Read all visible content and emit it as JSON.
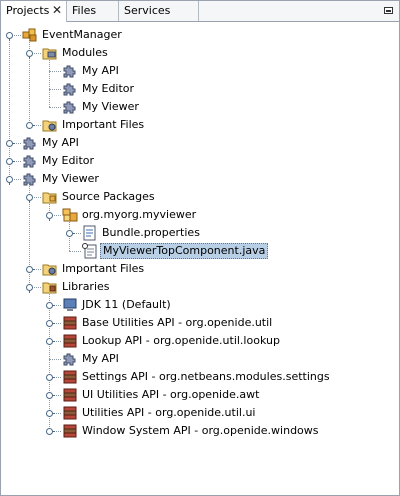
{
  "tabs": [
    {
      "label": "Projects",
      "active": true
    },
    {
      "label": "Files",
      "active": false
    },
    {
      "label": "Services",
      "active": false
    }
  ],
  "tree": [
    {
      "label": "EventManager",
      "depth": 0,
      "icon": "suite-icon",
      "state": "open"
    },
    {
      "label": "Modules",
      "depth": 1,
      "icon": "modules-folder-icon",
      "state": "open"
    },
    {
      "label": "My API",
      "depth": 2,
      "icon": "module-icon",
      "state": "leaf"
    },
    {
      "label": "My Editor",
      "depth": 2,
      "icon": "module-icon",
      "state": "leaf"
    },
    {
      "label": "My Viewer",
      "depth": 2,
      "icon": "module-icon",
      "state": "leaf"
    },
    {
      "label": "Important Files",
      "depth": 1,
      "icon": "important-files-icon",
      "state": "closed"
    },
    {
      "label": "My API",
      "depth": 0,
      "icon": "module-icon",
      "state": "closed"
    },
    {
      "label": "My Editor",
      "depth": 0,
      "icon": "module-icon",
      "state": "closed"
    },
    {
      "label": "My Viewer",
      "depth": 0,
      "icon": "module-icon",
      "state": "open"
    },
    {
      "label": "Source Packages",
      "depth": 1,
      "icon": "source-packages-icon",
      "state": "open"
    },
    {
      "label": "org.myorg.myviewer",
      "depth": 2,
      "icon": "package-icon",
      "state": "open"
    },
    {
      "label": "Bundle.properties",
      "depth": 3,
      "icon": "properties-file-icon",
      "state": "closed"
    },
    {
      "label": "MyViewerTopComponent.java",
      "depth": 3,
      "icon": "java-file-icon",
      "state": "leaf",
      "selected": true
    },
    {
      "label": "Important Files",
      "depth": 1,
      "icon": "important-files-icon",
      "state": "closed"
    },
    {
      "label": "Libraries",
      "depth": 1,
      "icon": "libraries-icon",
      "state": "open"
    },
    {
      "label": "JDK 11 (Default)",
      "depth": 2,
      "icon": "jdk-icon",
      "state": "closed"
    },
    {
      "label": "Base Utilities API - org.openide.util",
      "depth": 2,
      "icon": "library-jar-icon",
      "state": "closed"
    },
    {
      "label": "Lookup API - org.openide.util.lookup",
      "depth": 2,
      "icon": "library-jar-icon",
      "state": "closed"
    },
    {
      "label": "My API",
      "depth": 2,
      "icon": "module-icon",
      "state": "leaf"
    },
    {
      "label": "Settings API - org.netbeans.modules.settings",
      "depth": 2,
      "icon": "library-jar-icon",
      "state": "closed"
    },
    {
      "label": "UI Utilities API - org.openide.awt",
      "depth": 2,
      "icon": "library-jar-icon",
      "state": "closed"
    },
    {
      "label": "Utilities API - org.openide.util.ui",
      "depth": 2,
      "icon": "library-jar-icon",
      "state": "closed"
    },
    {
      "label": "Window System API - org.openide.windows",
      "depth": 2,
      "icon": "library-jar-icon",
      "state": "closed"
    }
  ]
}
